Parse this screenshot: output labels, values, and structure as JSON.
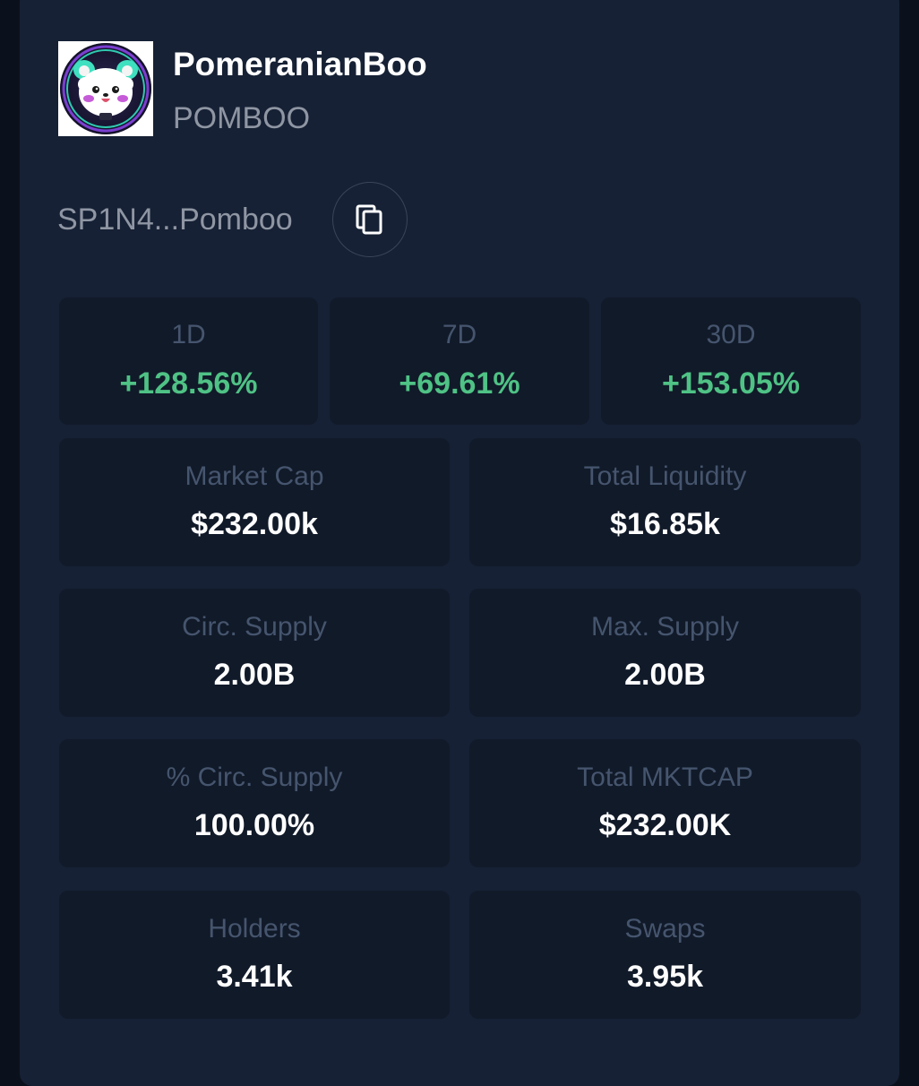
{
  "token": {
    "name": "PomeranianBoo",
    "symbol": "POMBOO",
    "address": "SP1N4...Pomboo",
    "logo_icon": "pomeranian-logo-icon",
    "copy_icon": "copy-icon"
  },
  "colors": {
    "card_background": "#162135",
    "tile_background": "#111a29",
    "positive": "#4fc285",
    "label": "#46556e",
    "muted_text": "#8f96a3"
  },
  "price_changes": [
    {
      "period": "1D",
      "change": "+128.56%"
    },
    {
      "period": "7D",
      "change": "+69.61%"
    },
    {
      "period": "30D",
      "change": "+153.05%"
    }
  ],
  "stats": {
    "market_cap": {
      "label": "Market Cap",
      "value": "$232.00k"
    },
    "total_liquidity": {
      "label": "Total Liquidity",
      "value": "$16.85k"
    },
    "circ_supply": {
      "label": "Circ. Supply",
      "value": "2.00B"
    },
    "max_supply": {
      "label": "Max. Supply",
      "value": "2.00B"
    },
    "pct_circ_supply": {
      "label": "% Circ. Supply",
      "value": "100.00%"
    },
    "total_mktcap": {
      "label": "Total MKTCAP",
      "value": "$232.00K"
    },
    "holders": {
      "label": "Holders",
      "value": "3.41k"
    },
    "swaps": {
      "label": "Swaps",
      "value": "3.95k"
    }
  }
}
